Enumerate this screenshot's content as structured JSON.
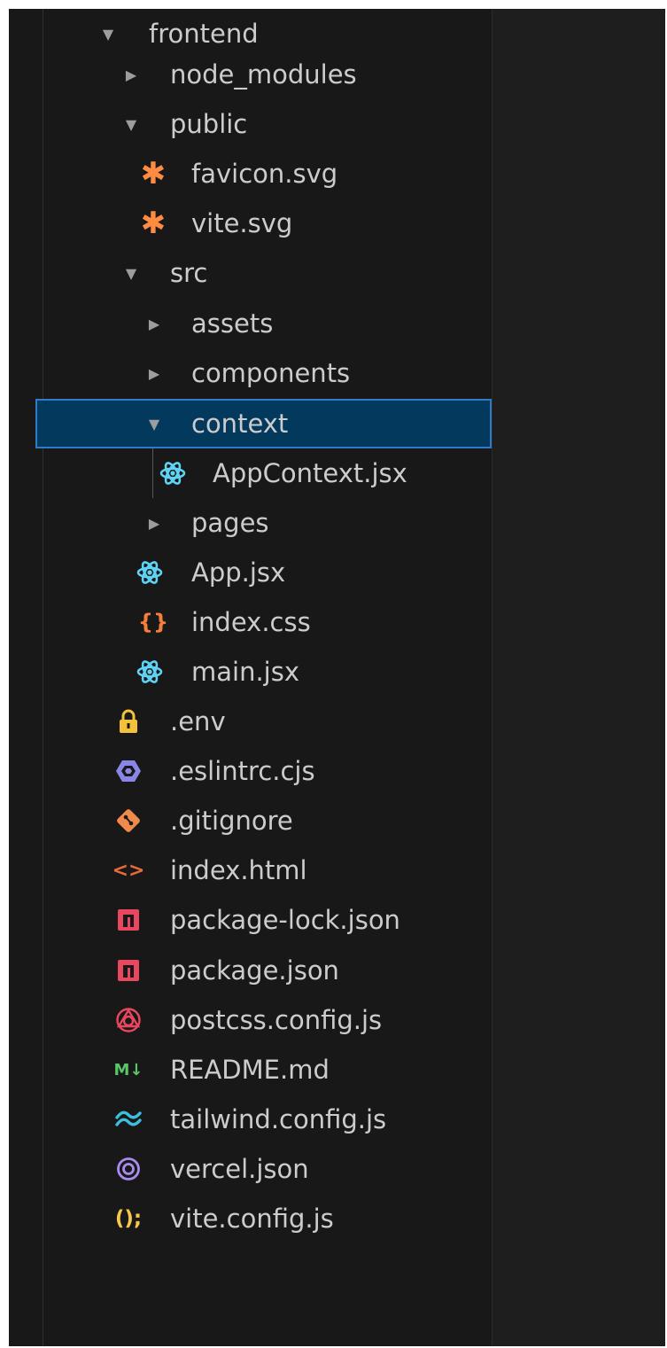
{
  "explorer": {
    "colors": {
      "background": "#181818",
      "text": "#cccccc",
      "selection_bg": "#04395e",
      "selection_border": "#2e7cc7"
    },
    "items": [
      {
        "label": "frontend",
        "kind": "folder",
        "expanded": true,
        "icon": "chevron-down-icon"
      },
      {
        "label": "node_modules",
        "kind": "folder",
        "expanded": false,
        "icon": "chevron-right-icon"
      },
      {
        "label": "public",
        "kind": "folder",
        "expanded": true,
        "icon": "chevron-down-icon"
      },
      {
        "label": "favicon.svg",
        "kind": "file",
        "icon": "svg-file-icon"
      },
      {
        "label": "vite.svg",
        "kind": "file",
        "icon": "svg-file-icon"
      },
      {
        "label": "src",
        "kind": "folder",
        "expanded": true,
        "icon": "chevron-down-icon"
      },
      {
        "label": "assets",
        "kind": "folder",
        "expanded": false,
        "icon": "chevron-right-icon"
      },
      {
        "label": "components",
        "kind": "folder",
        "expanded": false,
        "icon": "chevron-right-icon"
      },
      {
        "label": "context",
        "kind": "folder",
        "expanded": true,
        "selected": true,
        "icon": "chevron-down-icon"
      },
      {
        "label": "AppContext.jsx",
        "kind": "file",
        "icon": "react-icon"
      },
      {
        "label": "pages",
        "kind": "folder",
        "expanded": false,
        "icon": "chevron-right-icon"
      },
      {
        "label": "App.jsx",
        "kind": "file",
        "icon": "react-icon"
      },
      {
        "label": "index.css",
        "kind": "file",
        "icon": "css-braces-icon"
      },
      {
        "label": "main.jsx",
        "kind": "file",
        "icon": "react-icon"
      },
      {
        "label": ".env",
        "kind": "file",
        "icon": "lock-icon"
      },
      {
        "label": ".eslintrc.cjs",
        "kind": "file",
        "icon": "eslint-icon"
      },
      {
        "label": ".gitignore",
        "kind": "file",
        "icon": "git-icon"
      },
      {
        "label": "index.html",
        "kind": "file",
        "icon": "html-brackets-icon"
      },
      {
        "label": "package-lock.json",
        "kind": "file",
        "icon": "npm-icon"
      },
      {
        "label": "package.json",
        "kind": "file",
        "icon": "npm-icon"
      },
      {
        "label": "postcss.config.js",
        "kind": "file",
        "icon": "postcss-icon"
      },
      {
        "label": "README.md",
        "kind": "file",
        "icon": "markdown-icon"
      },
      {
        "label": "tailwind.config.js",
        "kind": "file",
        "icon": "tailwind-icon"
      },
      {
        "label": "vercel.json",
        "kind": "file",
        "icon": "vercel-icon"
      },
      {
        "label": "vite.config.js",
        "kind": "file",
        "icon": "vite-config-icon"
      }
    ]
  }
}
